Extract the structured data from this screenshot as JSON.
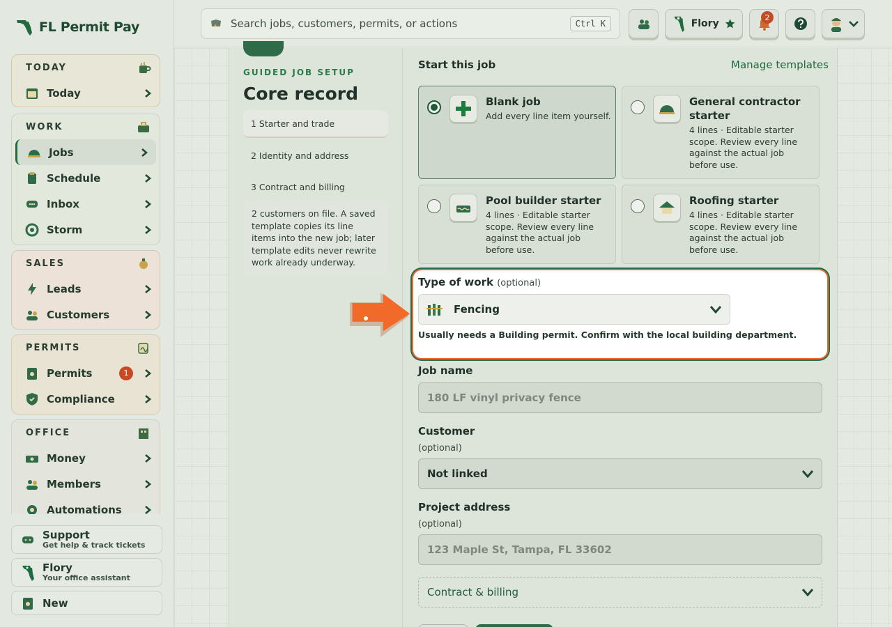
{
  "brand": {
    "name": "FL Permit Pay"
  },
  "sidebar": {
    "groups": [
      {
        "title": "TODAY",
        "items": [
          {
            "label": "Today"
          }
        ]
      },
      {
        "title": "WORK",
        "items": [
          {
            "label": "Jobs"
          },
          {
            "label": "Schedule"
          },
          {
            "label": "Inbox"
          },
          {
            "label": "Storm"
          }
        ]
      },
      {
        "title": "SALES",
        "items": [
          {
            "label": "Leads"
          },
          {
            "label": "Customers"
          }
        ]
      },
      {
        "title": "PERMITS",
        "items": [
          {
            "label": "Permits",
            "badge": "1"
          },
          {
            "label": "Compliance"
          }
        ]
      },
      {
        "title": "OFFICE",
        "items": [
          {
            "label": "Money"
          },
          {
            "label": "Members"
          },
          {
            "label": "Automations"
          }
        ]
      }
    ],
    "active_item": "Jobs",
    "footer": {
      "support": {
        "title": "Support",
        "subtitle": "Get help & track tickets"
      },
      "flory": {
        "title": "Flory",
        "subtitle": "Your office assistant"
      },
      "new": {
        "title": "New"
      }
    }
  },
  "topbar": {
    "search_placeholder": "Search jobs, customers, permits, or actions",
    "shortcut": "Ctrl K",
    "assistant_label": "Flory",
    "notification_count": "2"
  },
  "setup": {
    "eyebrow": "GUIDED JOB SETUP",
    "title": "Core record",
    "steps": [
      "1 Starter and trade",
      "2 Identity and address",
      "3 Contract and billing"
    ],
    "note": "2 customers on file. A saved template copies its line items into the new job; later template edits never rewrite work already underway."
  },
  "starter": {
    "heading": "Start this job",
    "manage_link": "Manage templates",
    "cards": [
      {
        "title": "Blank job",
        "desc": "Add every line item yourself.",
        "selected": true
      },
      {
        "title": "General contractor starter",
        "desc": "4 lines · Editable starter scope. Review every line against the actual job before use.",
        "selected": false
      },
      {
        "title": "Pool builder starter",
        "desc": "4 lines · Editable starter scope. Review every line against the actual job before use.",
        "selected": false
      },
      {
        "title": "Roofing starter",
        "desc": "4 lines · Editable starter scope. Review every line against the actual job before use.",
        "selected": false
      }
    ]
  },
  "type_of_work": {
    "label": "Type of work",
    "optional": "(optional)",
    "value": "Fencing",
    "hint": "Usually needs a Building permit. Confirm with the local building department."
  },
  "fields": {
    "job_name": {
      "label": "Job name",
      "placeholder": "180 LF vinyl privacy fence"
    },
    "customer": {
      "label": "Customer",
      "sub": "(optional)",
      "value": "Not linked"
    },
    "address": {
      "label": "Project address",
      "sub": "(optional)",
      "placeholder": "123 Maple St, Tampa, FL 33602"
    },
    "contract": {
      "label": "Contract & billing"
    }
  },
  "colors": {
    "accent": "#1f6b3e",
    "highlight": "#ec6a2c",
    "badge": "#c74a25"
  }
}
